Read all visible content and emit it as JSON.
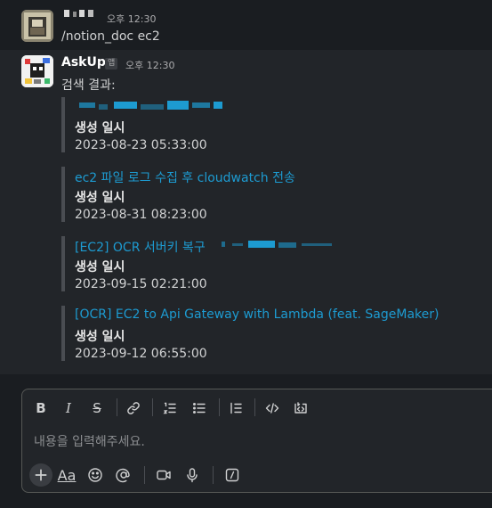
{
  "messages": {
    "user": {
      "time": "오후 12:30",
      "text": "/notion_doc ec2"
    },
    "bot": {
      "name": "AskUp",
      "badge": "앱",
      "time": "오후 12:30",
      "intro": "검색 결과:",
      "results": [
        {
          "title": "",
          "label": "생성 일시",
          "date": "2023-08-23 05:33:00"
        },
        {
          "title": "ec2 파일 로그 수집 후 cloudwatch 전송",
          "label": "생성 일시",
          "date": "2023-08-31 08:23:00"
        },
        {
          "title": "[EC2] OCR 서버키 복구",
          "label": "생성 일시",
          "date": "2023-09-15 02:21:00"
        },
        {
          "title": "[OCR] EC2 to Api Gateway with Lambda (feat. SageMaker)",
          "label": "생성 일시",
          "date": "2023-09-12 06:55:00"
        }
      ]
    }
  },
  "composer": {
    "placeholder": "내용을 입력해주세요.",
    "toolbar": [
      "bold-icon",
      "italic-icon",
      "strikethrough-icon",
      "link-icon",
      "ordered-list-icon",
      "bullet-list-icon",
      "blockquote-icon",
      "code-icon",
      "code-block-icon"
    ],
    "bottom": [
      "plus-icon",
      "format-icon",
      "emoji-icon",
      "mention-icon",
      "video-icon",
      "microphone-icon",
      "slash-command-icon"
    ],
    "format_label": "Aa"
  },
  "colors": {
    "background": "#1a1d21",
    "link": "#1d9bd1",
    "text": "#d1d2d3"
  }
}
